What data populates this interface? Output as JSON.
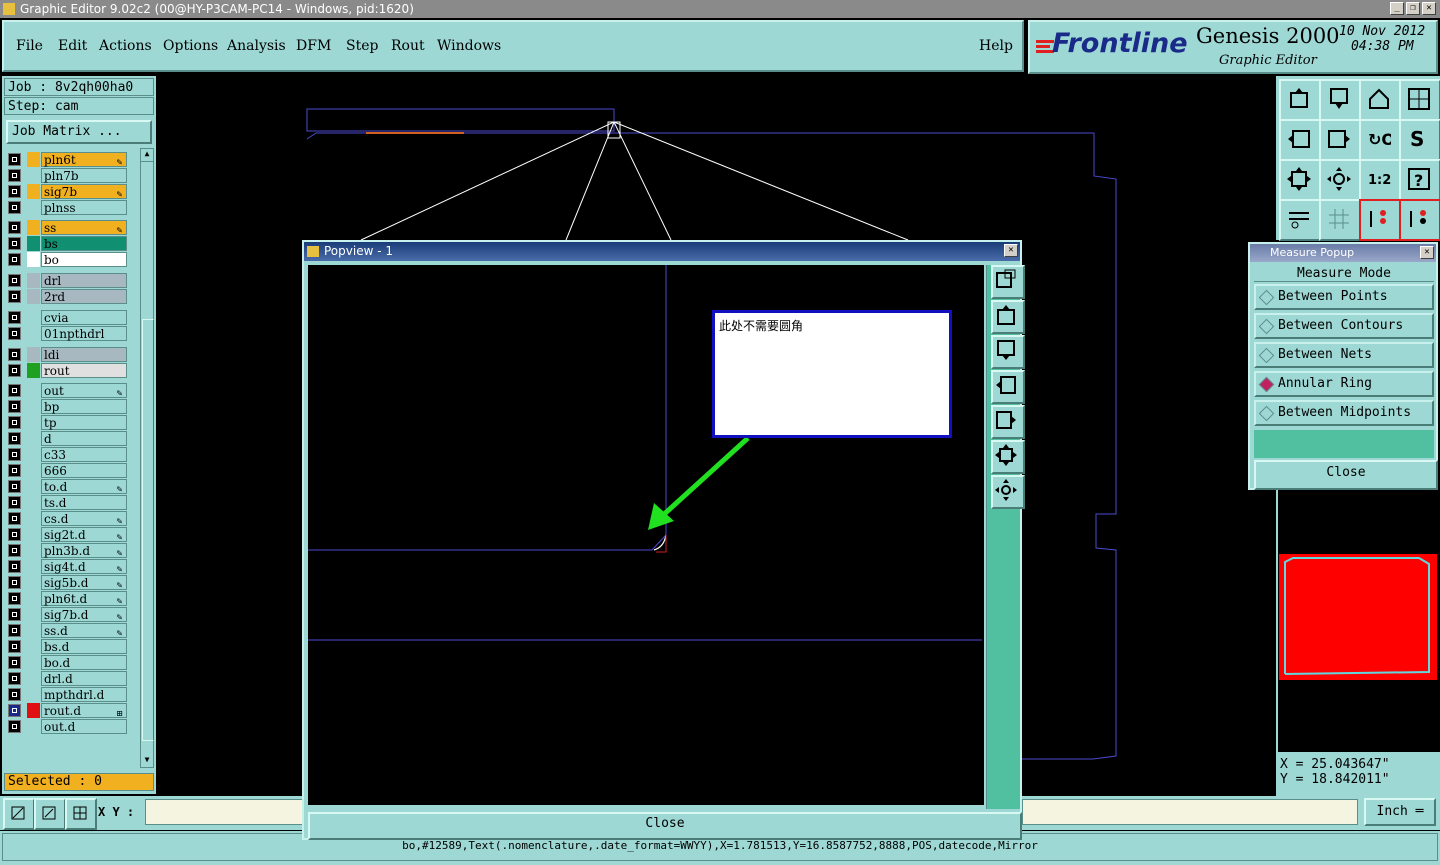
{
  "window": {
    "title": "Graphic Editor 9.02c2 (00@HY-P3CAM-PC14 - Windows, pid:1620)"
  },
  "menu": [
    "File",
    "Edit",
    "Actions",
    "Options",
    "Analysis",
    "DFM",
    "Step",
    "Rout",
    "Windows"
  ],
  "help_label": "Help",
  "brand": {
    "logo": "Frontline",
    "product": "Genesis 2000",
    "subtitle": "Graphic Editor",
    "date": "10 Nov 2012",
    "time": "04:38 PM"
  },
  "job": {
    "job_label": "Job : 8v2qh00ha0",
    "step_label": "Step: cam",
    "matrix_button": "Job Matrix ..."
  },
  "layers": [
    {
      "name": "pln6t",
      "color": "#f0b020",
      "name_bg": "#f0b020",
      "flag": "✎"
    },
    {
      "name": "pln7b",
      "color": "#9dd8d4",
      "name_bg": "#9dd8d4",
      "flag": ""
    },
    {
      "name": "sig7b",
      "color": "#f0b020",
      "name_bg": "#f0b020",
      "flag": "✎"
    },
    {
      "name": "plnss",
      "color": "#9dd8d4",
      "name_bg": "#9dd8d4",
      "flag": ""
    },
    {
      "name": "ss",
      "color": "#f0b020",
      "name_bg": "#f0b020",
      "flag": "✎"
    },
    {
      "name": "bs",
      "color": "#109070",
      "name_bg": "#109070",
      "flag": ""
    },
    {
      "name": "bo",
      "color": "#ffffff",
      "name_bg": "#ffffff",
      "flag": ""
    },
    {
      "name": "drl",
      "color": "#a8b8c0",
      "name_bg": "#a8b8c0",
      "flag": ""
    },
    {
      "name": "2rd",
      "color": "#a8b8c0",
      "name_bg": "#a8b8c0",
      "flag": ""
    },
    {
      "name": "cvia",
      "color": "#9dd8d4",
      "name_bg": "#9dd8d4",
      "flag": ""
    },
    {
      "name": "01npthdrl",
      "color": "#9dd8d4",
      "name_bg": "#9dd8d4",
      "flag": ""
    },
    {
      "name": "ldi",
      "color": "#a8b8c0",
      "name_bg": "#a8b8c0",
      "flag": ""
    },
    {
      "name": "rout",
      "color": "#20a020",
      "name_bg": "#e0e0e0",
      "flag": ""
    },
    {
      "name": "out",
      "color": "#9dd8d4",
      "name_bg": "#9dd8d4",
      "flag": "✎"
    },
    {
      "name": "bp",
      "color": "#9dd8d4",
      "name_bg": "#9dd8d4",
      "flag": ""
    },
    {
      "name": "tp",
      "color": "#9dd8d4",
      "name_bg": "#9dd8d4",
      "flag": ""
    },
    {
      "name": "d",
      "color": "#9dd8d4",
      "name_bg": "#9dd8d4",
      "flag": ""
    },
    {
      "name": "c33",
      "color": "#9dd8d4",
      "name_bg": "#9dd8d4",
      "flag": ""
    },
    {
      "name": "666",
      "color": "#9dd8d4",
      "name_bg": "#9dd8d4",
      "flag": ""
    },
    {
      "name": "to.d",
      "color": "#9dd8d4",
      "name_bg": "#9dd8d4",
      "flag": "✎"
    },
    {
      "name": "ts.d",
      "color": "#9dd8d4",
      "name_bg": "#9dd8d4",
      "flag": ""
    },
    {
      "name": "cs.d",
      "color": "#9dd8d4",
      "name_bg": "#9dd8d4",
      "flag": "✎"
    },
    {
      "name": "sig2t.d",
      "color": "#9dd8d4",
      "name_bg": "#9dd8d4",
      "flag": "✎"
    },
    {
      "name": "pln3b.d",
      "color": "#9dd8d4",
      "name_bg": "#9dd8d4",
      "flag": "✎"
    },
    {
      "name": "sig4t.d",
      "color": "#9dd8d4",
      "name_bg": "#9dd8d4",
      "flag": "✎"
    },
    {
      "name": "sig5b.d",
      "color": "#9dd8d4",
      "name_bg": "#9dd8d4",
      "flag": "✎"
    },
    {
      "name": "pln6t.d",
      "color": "#9dd8d4",
      "name_bg": "#9dd8d4",
      "flag": "✎"
    },
    {
      "name": "sig7b.d",
      "color": "#9dd8d4",
      "name_bg": "#9dd8d4",
      "flag": "✎"
    },
    {
      "name": "ss.d",
      "color": "#9dd8d4",
      "name_bg": "#9dd8d4",
      "flag": "✎"
    },
    {
      "name": "bs.d",
      "color": "#9dd8d4",
      "name_bg": "#9dd8d4",
      "flag": ""
    },
    {
      "name": "bo.d",
      "color": "#9dd8d4",
      "name_bg": "#9dd8d4",
      "flag": ""
    },
    {
      "name": "drl.d",
      "color": "#9dd8d4",
      "name_bg": "#9dd8d4",
      "flag": ""
    },
    {
      "name": "mpthdrl.d",
      "color": "#9dd8d4",
      "name_bg": "#9dd8d4",
      "flag": ""
    },
    {
      "name": "rout.d",
      "color": "#e01010",
      "name_bg": "#9dd8d4",
      "flag": "⊞"
    },
    {
      "name": "out.d",
      "color": "#9dd8d4",
      "name_bg": "#9dd8d4",
      "flag": ""
    }
  ],
  "selected_label": "Selected : 0",
  "xy_label": "X Y :",
  "popview": {
    "title": "Popview - 1",
    "note": "此处不需要圆角",
    "close_label": "Close"
  },
  "measure": {
    "title": "Measure Popup",
    "mode_label": "Measure Mode",
    "options": [
      "Between Points",
      "Between Contours",
      "Between Nets",
      "Annular Ring",
      "Between Midpoints"
    ],
    "selected": "Annular Ring",
    "close_label": "Close"
  },
  "coords": {
    "x": "X  =  25.043647\"",
    "y": "Y  =  18.842011\""
  },
  "units": "Inch",
  "status_text": "bo,#12589,Text(.nomenclature,.date_format=WWYY),X=1.781513,Y=16.8587752,8888,POS,datecode,Mirror",
  "colors": {
    "panel": "#9dd8d4",
    "highlight": "#f0b020",
    "preview_red": "#ff0000"
  }
}
